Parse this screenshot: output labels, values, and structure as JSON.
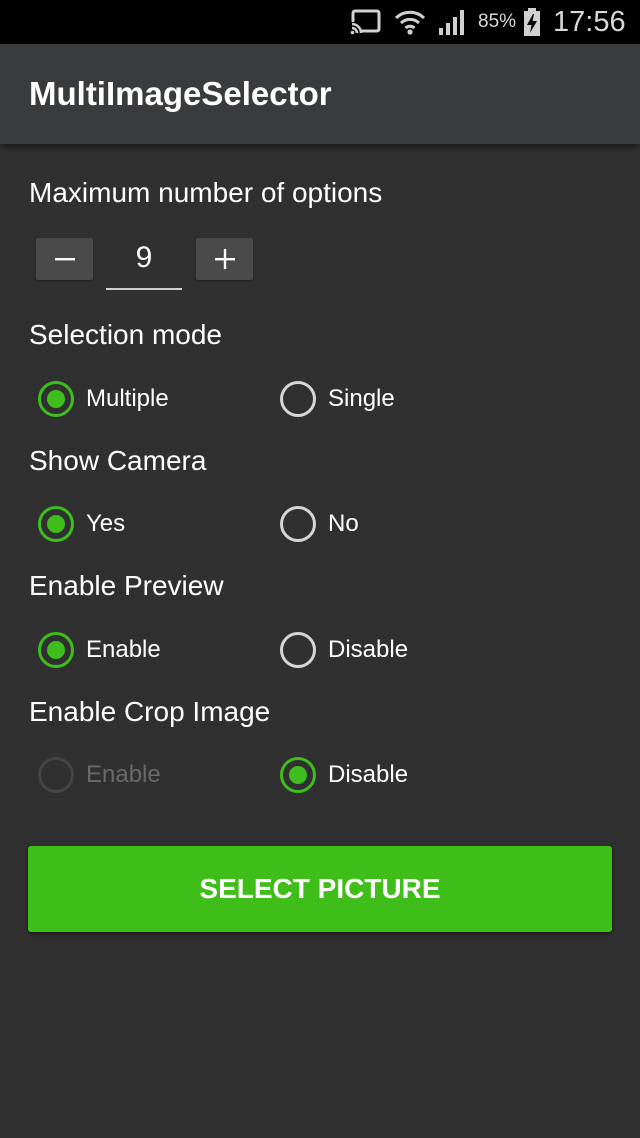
{
  "status_bar": {
    "battery": "85%",
    "time": "17:56",
    "icons": [
      "cast-icon",
      "wifi-icon",
      "signal-icon",
      "battery-charging-icon"
    ]
  },
  "app_bar": {
    "title": "MultiImageSelector"
  },
  "max_options": {
    "label": "Maximum number of options",
    "value": "9",
    "decrement_icon": "minus-icon",
    "increment_icon": "plus-icon"
  },
  "selection_mode": {
    "label": "Selection mode",
    "options": [
      {
        "label": "Multiple",
        "checked": true
      },
      {
        "label": "Single",
        "checked": false
      }
    ]
  },
  "show_camera": {
    "label": "Show Camera",
    "options": [
      {
        "label": "Yes",
        "checked": true
      },
      {
        "label": "No",
        "checked": false
      }
    ]
  },
  "enable_preview": {
    "label": "Enable Preview",
    "options": [
      {
        "label": "Enable",
        "checked": true
      },
      {
        "label": "Disable",
        "checked": false
      }
    ]
  },
  "enable_crop": {
    "label": "Enable Crop Image",
    "options": [
      {
        "label": "Enable",
        "checked": false,
        "disabled": true
      },
      {
        "label": "Disable",
        "checked": true
      }
    ]
  },
  "select_button": {
    "label": "SELECT PICTURE"
  },
  "colors": {
    "accent": "#3dbe1c",
    "background": "#303030",
    "app_bar": "#3a3b3d",
    "status_bar": "#000000"
  }
}
